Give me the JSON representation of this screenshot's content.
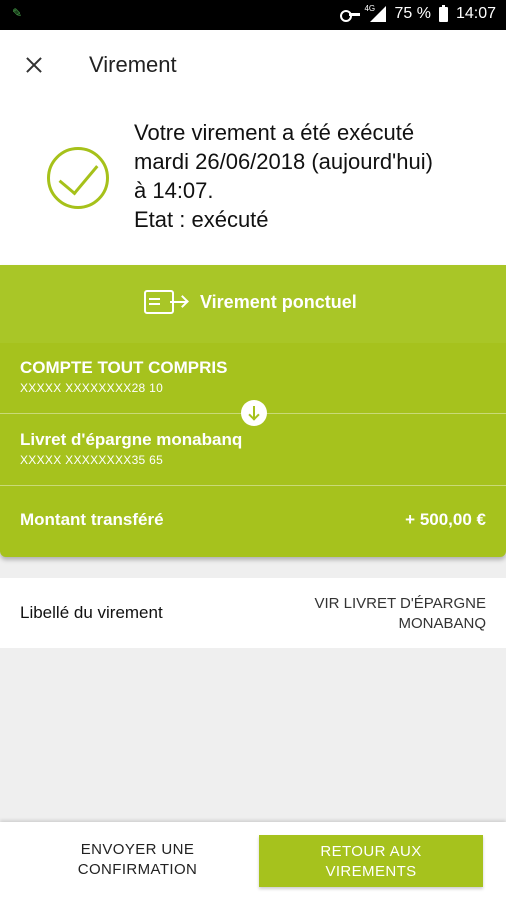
{
  "status_bar": {
    "signal_tag": "4G",
    "battery": "75 %",
    "time": "14:07"
  },
  "app_bar": {
    "title": "Virement"
  },
  "confirmation": {
    "line1": "Votre virement a été exécuté",
    "line2": "mardi 26/06/2018 (aujourd'hui)",
    "line3": "à 14:07.",
    "line4": "Etat : exécuté",
    "accent_color": "#a6c11a"
  },
  "transfer": {
    "type_label": "Virement ponctuel",
    "from": {
      "name": "COMPTE TOUT COMPRIS",
      "number": "XXXXX XXXXXXXX28 10"
    },
    "to": {
      "name": "Livret d'épargne monabanq",
      "number": "XXXXX XXXXXXXX35 65"
    },
    "amount_label": "Montant transféré",
    "amount_value": "+ 500,00 €",
    "panel_color": "#a6c21d"
  },
  "libelle": {
    "label": "Libellé du virement",
    "value_line1": "VIR LIVRET D'ÉPARGNE",
    "value_line2": "MONABANQ"
  },
  "footer": {
    "send_line1": "ENVOYER UNE",
    "send_line2": "CONFIRMATION",
    "return_line1": "RETOUR AUX",
    "return_line2": "VIREMENTS"
  }
}
